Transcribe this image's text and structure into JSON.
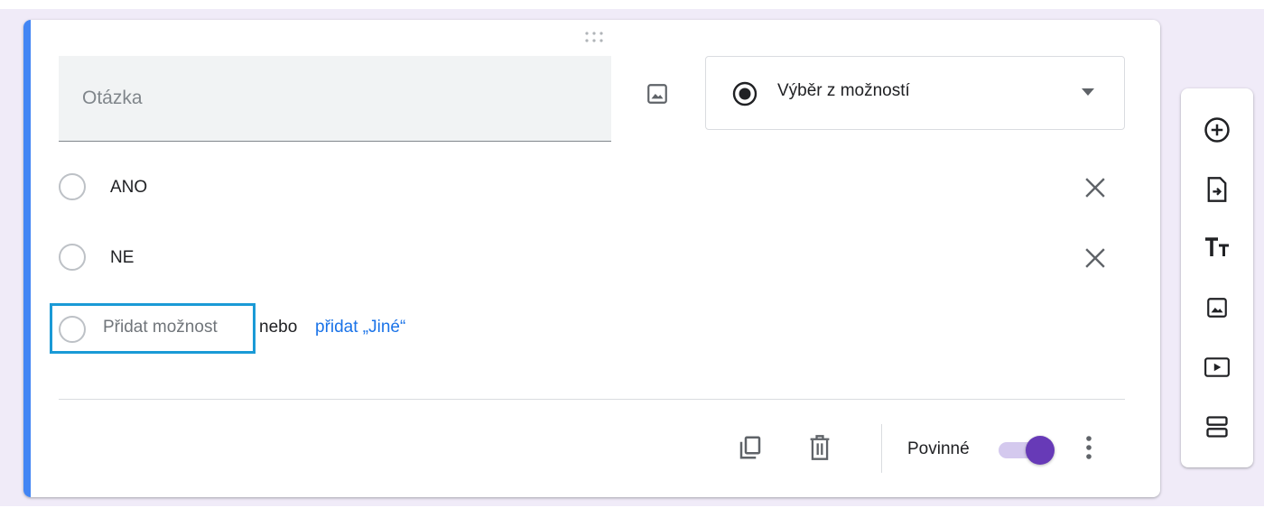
{
  "question": {
    "placeholder": "Otázka",
    "value": ""
  },
  "question_type": {
    "selected_label": "Výběr z možností",
    "icon": "radio-button-checked-icon"
  },
  "options": [
    {
      "label": "ANO"
    },
    {
      "label": "NE"
    }
  ],
  "add_option": {
    "placeholder": "Přidat možnost",
    "or_text": "nebo",
    "add_other_label": "přidat „Jiné“"
  },
  "footer": {
    "required_label": "Povinné",
    "required_on": true
  },
  "sidebar_tools": [
    {
      "icon": "add-circle-icon"
    },
    {
      "icon": "import-questions-icon"
    },
    {
      "icon": "title-text-icon"
    },
    {
      "icon": "image-icon"
    },
    {
      "icon": "video-icon"
    },
    {
      "icon": "section-icon"
    }
  ],
  "colors": {
    "accent": "#4285f4",
    "toggle_thumb": "#673ab7",
    "toggle_track": "#d4c9ee",
    "link": "#1a73e8",
    "focus_box": "#1a9ad6",
    "background": "#f0ebf8"
  }
}
